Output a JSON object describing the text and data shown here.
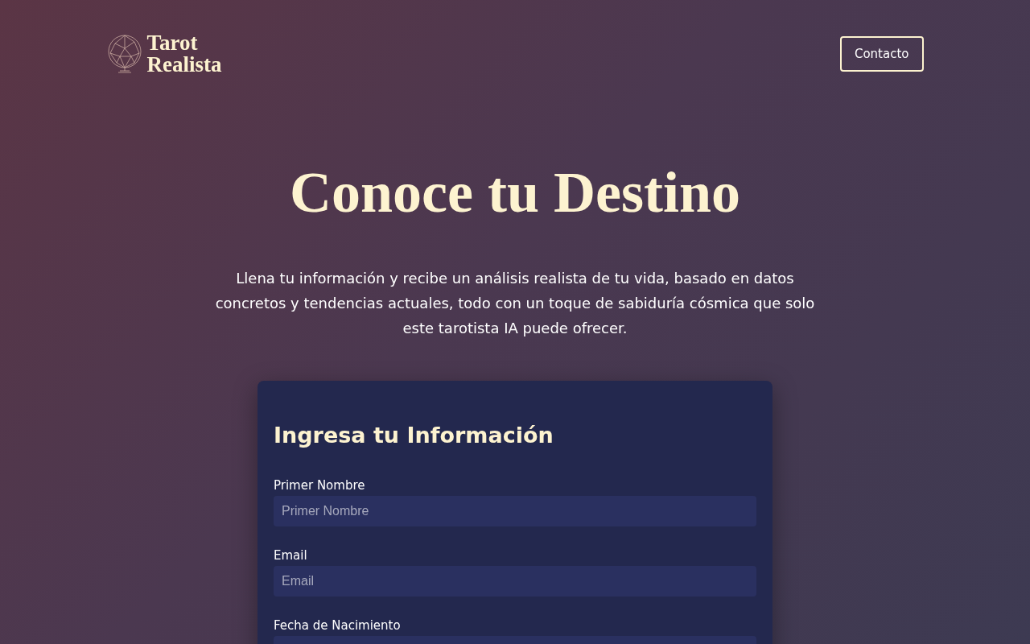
{
  "header": {
    "logo_text": [
      "Tarot",
      "Realista"
    ],
    "contact_button": "Contacto"
  },
  "hero": {
    "title": "Conoce tu Destino",
    "description": "Llena tu información y recibe un análisis realista de tu vida, basado en datos concretos y tendencias actuales, todo con un toque de sabiduría cósmica que solo este tarotista IA puede ofrecer."
  },
  "form": {
    "title": "Ingresa tu Información",
    "fields": [
      {
        "kind": "text",
        "label": "Primer Nombre",
        "placeholder": "Primer Nombre"
      },
      {
        "kind": "text",
        "label": "Email",
        "placeholder": "Email"
      },
      {
        "kind": "date",
        "label": "Fecha de Nacimiento"
      }
    ]
  }
}
